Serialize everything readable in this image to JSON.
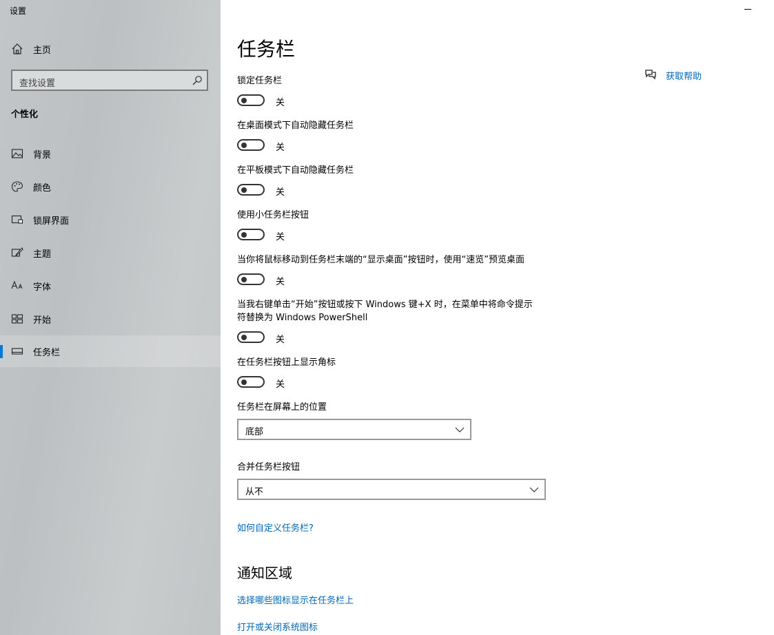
{
  "window": {
    "title": "设置"
  },
  "sidebar": {
    "home_label": "主页",
    "search_placeholder": "查找设置",
    "group_title": "个性化",
    "items": [
      {
        "label": "背景",
        "icon": "picture-icon"
      },
      {
        "label": "颜色",
        "icon": "palette-icon"
      },
      {
        "label": "锁屏界面",
        "icon": "lock-screen-icon"
      },
      {
        "label": "主题",
        "icon": "theme-brush-icon"
      },
      {
        "label": "字体",
        "icon": "font-icon"
      },
      {
        "label": "开始",
        "icon": "start-grid-icon"
      },
      {
        "label": "任务栏",
        "icon": "taskbar-icon",
        "active": true
      }
    ]
  },
  "main": {
    "title": "任务栏",
    "help_label": "获取帮助",
    "settings": [
      {
        "label": "锁定任务栏",
        "state": "关"
      },
      {
        "label": "在桌面模式下自动隐藏任务栏",
        "state": "关"
      },
      {
        "label": "在平板模式下自动隐藏任务栏",
        "state": "关"
      },
      {
        "label": "使用小任务栏按钮",
        "state": "关"
      },
      {
        "label": "当你将鼠标移动到任务栏末端的“显示桌面”按钮时，使用“速览”预览桌面",
        "state": "关"
      },
      {
        "label": "当我右键单击“开始”按钮或按下 Windows 键+X 时，在菜单中将命令提示符替换为 Windows PowerShell",
        "state": "关"
      },
      {
        "label": "在任务栏按钮上显示角标",
        "state": "关"
      }
    ],
    "position": {
      "label": "任务栏在屏幕上的位置",
      "value": "底部"
    },
    "combine": {
      "label": "合并任务栏按钮",
      "value": "从不"
    },
    "customize_link": "如何自定义任务栏?",
    "notification_title": "通知区域",
    "notification_links": [
      "选择哪些图标显示在任务栏上",
      "打开或关闭系统图标"
    ]
  },
  "colors": {
    "accent": "#0078d7",
    "link": "#0067b8"
  }
}
